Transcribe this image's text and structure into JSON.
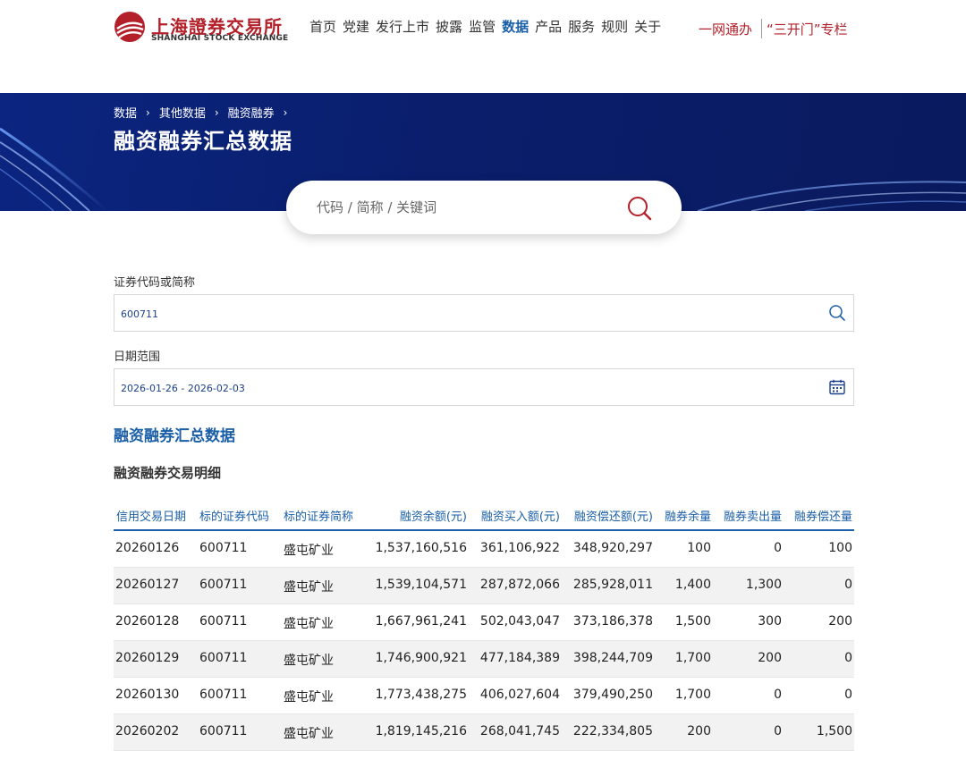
{
  "header": {
    "logo_cn": "上海證券交易所",
    "logo_en": "SHANGHAI STOCK EXCHANGE",
    "nav": [
      "首页",
      "党建",
      "发行上市",
      "披露",
      "监管",
      "数据",
      "产品",
      "服务",
      "规则",
      "关于"
    ],
    "active_nav": "数据",
    "top_link_1": "一网通办",
    "top_link_2": "“三开门”专栏"
  },
  "banner": {
    "breadcrumb": [
      "数据",
      "其他数据",
      "融资融券"
    ],
    "title": "融资融券汇总数据"
  },
  "search": {
    "placeholder": "代码 / 简称 / 关键词"
  },
  "filters": {
    "code_label": "证券代码或简称",
    "code_value": "600711",
    "date_label": "日期范围",
    "date_value": "2026-01-26 - 2026-02-03"
  },
  "section_title": "融资融券汇总数据",
  "sub_title": "融资融券交易明细",
  "table": {
    "headers": [
      "信用交易日期",
      "标的证券代码",
      "标的证券简称",
      "融资余额(元)",
      "融资买入额(元)",
      "融资偿还额(元)",
      "融券余量",
      "融券卖出量",
      "融券偿还量"
    ],
    "rows": [
      [
        "20260126",
        "600711",
        "盛屯矿业",
        "1,537,160,516",
        "361,106,922",
        "348,920,297",
        "100",
        "0",
        "100"
      ],
      [
        "20260127",
        "600711",
        "盛屯矿业",
        "1,539,104,571",
        "287,872,066",
        "285,928,011",
        "1,400",
        "1,300",
        "0"
      ],
      [
        "20260128",
        "600711",
        "盛屯矿业",
        "1,667,961,241",
        "502,043,047",
        "373,186,378",
        "1,500",
        "300",
        "200"
      ],
      [
        "20260129",
        "600711",
        "盛屯矿业",
        "1,746,900,921",
        "477,184,389",
        "398,244,709",
        "1,700",
        "200",
        "0"
      ],
      [
        "20260130",
        "600711",
        "盛屯矿业",
        "1,773,438,275",
        "406,027,604",
        "379,490,250",
        "1,700",
        "0",
        "0"
      ],
      [
        "20260202",
        "600711",
        "盛屯矿业",
        "1,819,145,216",
        "268,041,745",
        "222,334,805",
        "200",
        "0",
        "1,500"
      ]
    ]
  },
  "colors": {
    "brand_red": "#b3202a",
    "accent_blue": "#1b5fa8",
    "banner_navy": "#0a1e6c"
  }
}
